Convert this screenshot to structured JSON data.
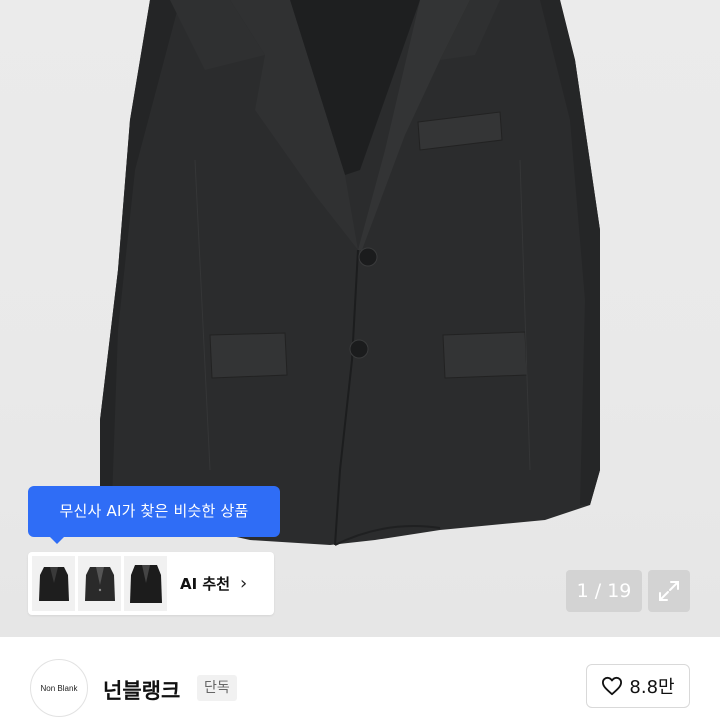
{
  "product": {
    "image_alt": "black single-breasted blazer",
    "image_counter": "1 / 19"
  },
  "ai_recommend": {
    "tooltip": "무신사 AI가 찾은 비슷한 상품",
    "label": "AI 추천",
    "chevron": "›",
    "thumbnails": [
      "jacket-thumb-1",
      "jacket-thumb-2",
      "jacket-thumb-3"
    ]
  },
  "brand": {
    "logo_text": "Non Blank",
    "name": "넌블랭크",
    "tag": "단독"
  },
  "likes": {
    "count": "8.8만",
    "icon": "heart-icon"
  },
  "colors": {
    "accent": "#2f6df6",
    "jacket": "#2b2c2d",
    "background": "#ebebeb"
  }
}
